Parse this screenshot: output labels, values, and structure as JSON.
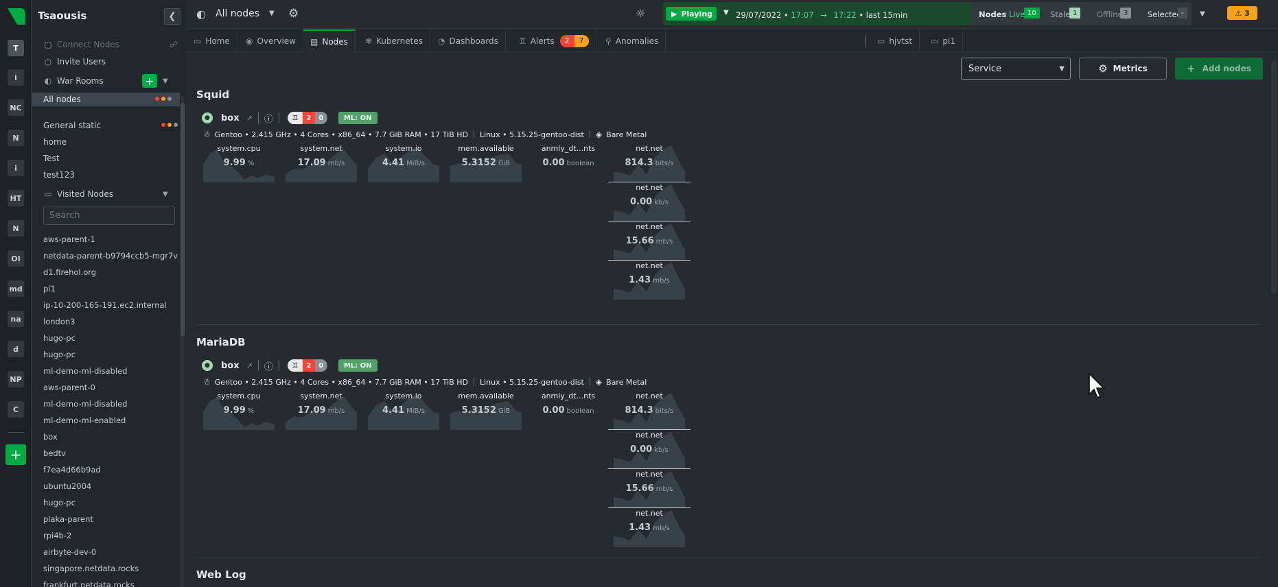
{
  "colors": {
    "accent": "#00ab44",
    "alarm_red": "#ff4136",
    "alarm_orange": "#f8a21a",
    "grey": "#8a9096"
  },
  "rail": {
    "spaces": [
      "T",
      "i",
      "NC",
      "N",
      "i",
      "HT",
      "N",
      "OI",
      "md",
      "na",
      "d",
      "NP",
      "C"
    ],
    "add_label": "+"
  },
  "sidebar": {
    "title": "Tsaousis",
    "connect_nodes": "Connect Nodes",
    "invite_users": "Invite Users",
    "war_rooms_label": "War Rooms",
    "rooms": [
      "All nodes",
      "General static",
      "home",
      "Test",
      "test123"
    ],
    "visited_label": "Visited Nodes",
    "search_placeholder": "Search",
    "nodes": [
      "aws-parent-1",
      "netdata-parent-b9794ccb5-mgr7v",
      "d1.firehol.org",
      "pi1",
      "ip-10-200-165-191.ec2.internal",
      "london3",
      "hugo-pc",
      "hugo-pc",
      "ml-demo-ml-disabled",
      "aws-parent-0",
      "ml-demo-ml-disabled",
      "ml-demo-ml-enabled",
      "box",
      "bedtv",
      "f7ea4d66b9ad",
      "ubuntu2004",
      "hugo-pc",
      "plaka-parent",
      "rpi4b-2",
      "airbyte-dev-0",
      "singapore.netdata.rocks",
      "frankfurt.netdata.rocks"
    ]
  },
  "header": {
    "room": "All nodes",
    "playing": "Playing",
    "date": "29/07/2022 •",
    "start_time": "17:07",
    "arrow": "→",
    "end_time": "17:22",
    "range": "• last 15min",
    "nodes_label": "Nodes",
    "live_label": "Live",
    "live_count": "10",
    "stale_label": "Stale",
    "stale_count": "1",
    "offline_label": "Offline",
    "offline_count": "3",
    "selected_label": "Selected",
    "selected_value": "-",
    "alert_count": "3"
  },
  "tabs": [
    {
      "label": "Home",
      "icon": "monitor-icon"
    },
    {
      "label": "Overview",
      "icon": "overview-icon"
    },
    {
      "label": "Nodes",
      "icon": "nodes-icon"
    },
    {
      "label": "Kubernetes",
      "icon": "kubernetes-icon"
    },
    {
      "label": "Dashboards",
      "icon": "dashboards-icon"
    },
    {
      "label": "Alerts",
      "icon": "bell-icon",
      "critical": "2",
      "warning": "7"
    },
    {
      "label": "Anomalies",
      "icon": "anomalies-icon"
    },
    {
      "label": "hjvtst",
      "icon": "monitor-icon"
    },
    {
      "label": "pi1",
      "icon": "monitor-icon"
    }
  ],
  "toolbar": {
    "group_by": "Service",
    "metrics_label": "Metrics",
    "add_nodes_label": "Add nodes"
  },
  "groups": [
    {
      "title": "Squid"
    },
    {
      "title": "MariaDB"
    },
    {
      "title": "Web Log"
    }
  ],
  "node": {
    "name": "box",
    "alarm_critical": "2",
    "alarm_warning": "0",
    "ml_label": "ML: ON",
    "os_specs": "Gentoo • 2.415 GHz • 4 Cores • x86_64 • 7.7 GiB RAM • 17 TiB HD",
    "kernel": "Linux • 5.15.25-gentoo-dist",
    "type": "Bare Metal"
  },
  "charts": [
    {
      "title": "system.cpu",
      "value": "9.99",
      "unit": "%"
    },
    {
      "title": "system.net",
      "value": "17.09",
      "unit": "mb/s"
    },
    {
      "title": "system.io",
      "value": "4.41",
      "unit": "MiB/s"
    },
    {
      "title": "mem.available",
      "value": "5.3152",
      "unit": "GiB"
    },
    {
      "title": "anmly_dt...nts",
      "value": "0.00",
      "unit": "boolean"
    },
    {
      "title": "net.net",
      "value": "814.3",
      "unit": "bits/s"
    },
    {
      "title": "net.net",
      "value": "0.00",
      "unit": "kb/s"
    },
    {
      "title": "net.net",
      "value": "15.66",
      "unit": "mb/s"
    },
    {
      "title": "net.net",
      "value": "1.43",
      "unit": "mb/s"
    }
  ]
}
